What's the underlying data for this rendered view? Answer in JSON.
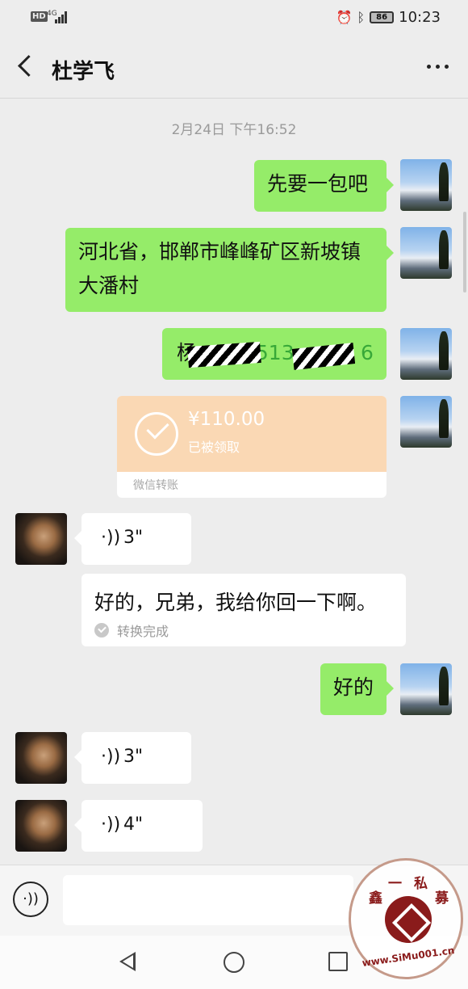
{
  "status_bar": {
    "hd": "HD",
    "network": "4G",
    "battery": "86",
    "time": "10:23",
    "icons": [
      "alarm-icon",
      "bluetooth-icon"
    ]
  },
  "header": {
    "title": "杜学飞"
  },
  "timestamp": "2月24日 下午16:52",
  "messages": [
    {
      "side": "me",
      "text": "先要一包吧"
    },
    {
      "side": "me",
      "text": "河北省，邯郸市峰峰矿区新坡镇大潘村",
      "line1": "河北省，邯郸市峰峰矿区新坡镇",
      "line2": "大潘村"
    },
    {
      "side": "me",
      "text_prefix": "杨",
      "text_mid": "1513",
      "text_suffix": "6",
      "redacted": true
    },
    {
      "side": "me",
      "type": "transfer",
      "amount": "¥110.00",
      "status": "已被领取",
      "label": "微信转账"
    },
    {
      "side": "them",
      "type": "voice",
      "duration": "3\""
    },
    {
      "side": "them",
      "type": "voice-text",
      "text": "好的，兄弟，我给你回一下啊。",
      "status": "转换完成"
    },
    {
      "side": "me",
      "text": "好的"
    },
    {
      "side": "them",
      "type": "voice",
      "duration": "3\""
    },
    {
      "side": "them",
      "type": "voice",
      "duration": "4\""
    }
  ],
  "watermark": {
    "chars": [
      "鑫",
      "一",
      "私",
      "募"
    ],
    "url": "www.SiMu001.cn"
  }
}
